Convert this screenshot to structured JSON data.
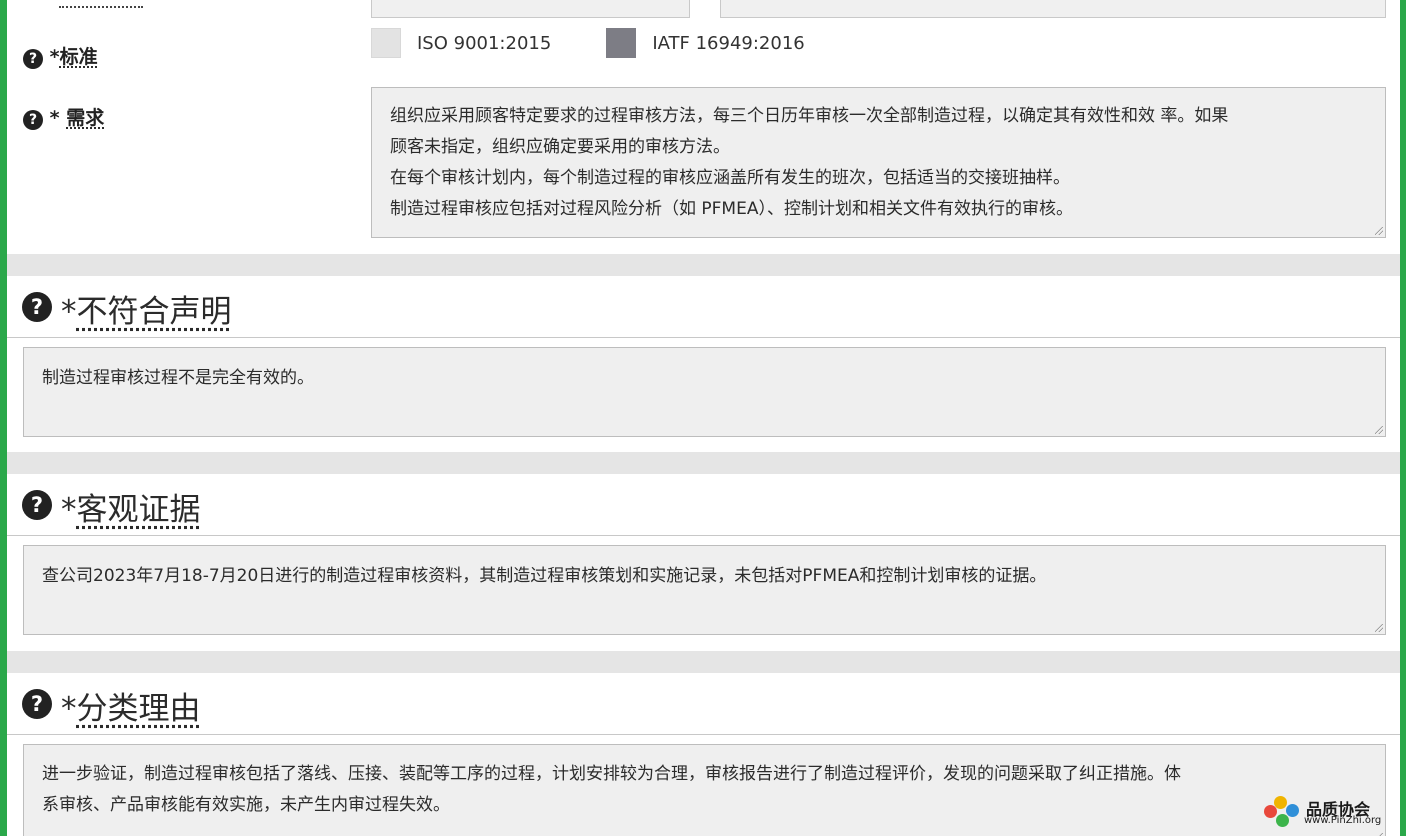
{
  "form": {
    "standard": {
      "required_mark": "*",
      "label": "标准",
      "options": [
        {
          "label": "ISO 9001:2015",
          "checked": false
        },
        {
          "label": "IATF 16949:2016",
          "checked": true
        }
      ]
    },
    "requirement": {
      "required_mark": "* ",
      "label": "需求",
      "lines": [
        "组织应采用顾客特定要求的过程审核方法，每三个日历年审核一次全部制造过程，以确定其有效性和效 率。如果",
        "顾客未指定，组织应确定要采用的审核方法。",
        "在每个审核计划内，每个制造过程的审核应涵盖所有发生的班次，包括适当的交接班抽样。",
        "制造过程审核应包括对过程风险分析（如 PFMEA）、控制计划和相关文件有效执行的审核。"
      ]
    }
  },
  "sections": {
    "nonconformity": {
      "required_mark": "*",
      "title": "不符合声明",
      "value": "制造过程审核过程不是完全有效的。"
    },
    "evidence": {
      "required_mark": "*",
      "title": "客观证据",
      "value": "查公司2023年7月18-7月20日进行的制造过程审核资料，其制造过程审核策划和实施记录，未包括对PFMEA和控制计划审核的证据。"
    },
    "rationale": {
      "required_mark": "*",
      "title": "分类理由",
      "lines": [
        "进一步验证，制造过程审核包括了落线、压接、装配等工序的过程，计划安排较为合理，审核报告进行了制造过程评价，发现的问题采取了纠正措施。体",
        "系审核、产品审核能有效实施，未产生内审过程失效。"
      ]
    }
  },
  "icons": {
    "help": "question-circle-icon",
    "help_glyph": "?"
  },
  "watermark": {
    "name": "品质协会",
    "url": "www.PinZhi.org"
  },
  "colors": {
    "frame": "#2aa84a",
    "field_bg": "#efefef",
    "checked": "#7d7d85"
  }
}
